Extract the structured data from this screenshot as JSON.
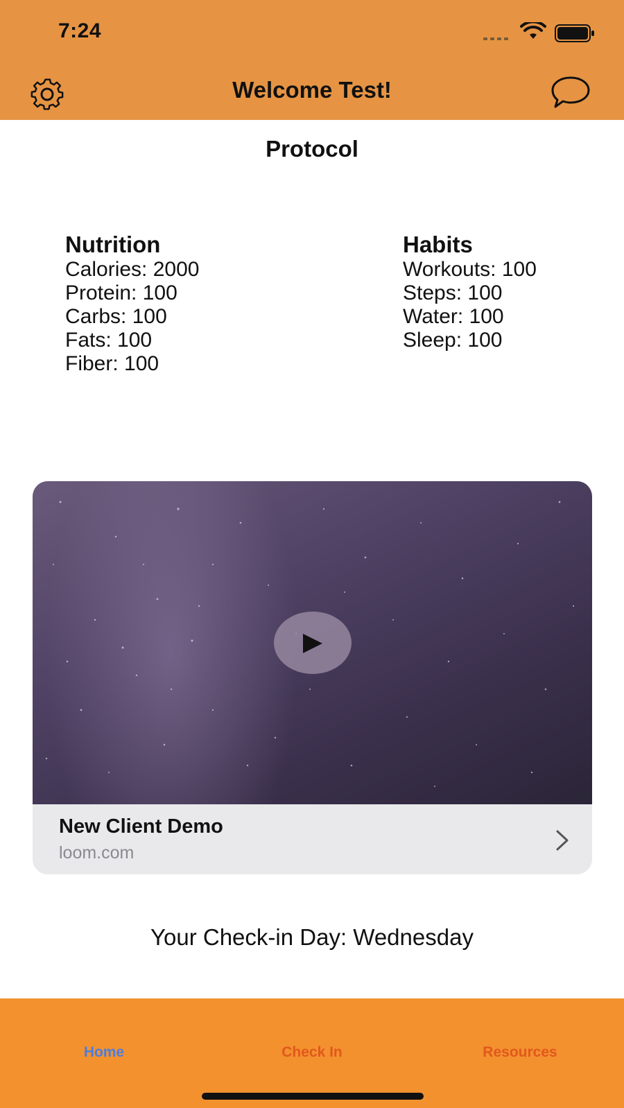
{
  "status_bar": {
    "time": "7:24",
    "signal_icon": "cellular-signal-icon",
    "wifi_icon": "wifi-icon",
    "battery_icon": "battery-icon"
  },
  "nav": {
    "title": "Welcome Test!",
    "left_icon": "gear-icon",
    "right_icon": "chat-bubble-icon"
  },
  "protocol": {
    "title": "Protocol",
    "nutrition": {
      "heading": "Nutrition",
      "rows": [
        "Calories: 2000",
        "Protein: 100",
        "Carbs: 100",
        "Fats: 100",
        "Fiber: 100"
      ]
    },
    "habits": {
      "heading": "Habits",
      "rows": [
        "Workouts: 100",
        "Steps: 100",
        "Water: 100",
        "Sleep: 100"
      ]
    }
  },
  "video_card": {
    "title": "New Client Demo",
    "domain": "loom.com",
    "play_icon": "play-icon",
    "chevron_icon": "chevron-right-icon"
  },
  "checkin_text": "Your Check-in Day: Wednesday",
  "tabs": [
    {
      "label": "Home",
      "selected": true
    },
    {
      "label": "Check In",
      "selected": false
    },
    {
      "label": "Resources",
      "selected": false
    }
  ],
  "colors": {
    "header_orange": "#E69443",
    "tabbar_orange": "#F3912F",
    "tab_selected": "#4a7ee0",
    "tab_unselected": "#e2581c"
  }
}
